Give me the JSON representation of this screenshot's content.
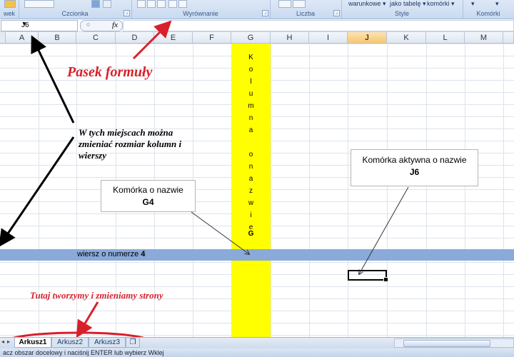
{
  "ribbon": {
    "groups": [
      "wek",
      "Czcionka",
      "Wyrównanie",
      "Liczba",
      "Style",
      "Komórki"
    ],
    "style_buttons": [
      "warunkowe",
      "jako tabelę",
      "komórki"
    ]
  },
  "formula_bar": {
    "name_box": "J6",
    "fx_label": "fx",
    "content": ""
  },
  "columns": [
    "A",
    "B",
    "C",
    "D",
    "E",
    "F",
    "G",
    "H",
    "I",
    "J",
    "K",
    "L",
    "M"
  ],
  "column_g_letters": [
    "K",
    "o",
    "l",
    "u",
    "m",
    "n",
    "a",
    "o",
    "n",
    "a",
    "z",
    "w",
    "i",
    "e",
    "G"
  ],
  "row_band_label": "wiersz o numerze",
  "row_band_number": "4",
  "annotations": {
    "formula_bar": "Pasek formuły",
    "resize_hint": "W tych miejscach można zmieniać rozmiar kolumn i wierszy",
    "sheets_hint": "Tutaj tworzymy i zmieniamy strony"
  },
  "callouts": {
    "g4_title": "Komórka o nazwie",
    "g4_name": "G4",
    "j6_title": "Komórka aktywna o nazwie",
    "j6_name": "J6"
  },
  "sheet_tabs": [
    {
      "label": "Arkusz1",
      "active": true
    },
    {
      "label": "Arkusz2",
      "active": false
    },
    {
      "label": "Arkusz3",
      "active": false
    }
  ],
  "status_text": "acz obszar docelowy i naciśnij ENTER lub wybierz Wklej",
  "colors": {
    "yellow": "#ffff00",
    "row_band": "#8aaad9",
    "annotation_red": "#d8202b",
    "active_header": "#f8c76f"
  },
  "icons": [
    "dropdown-arrow-icon",
    "insert-sheet-icon",
    "dialog-launcher-icon"
  ]
}
